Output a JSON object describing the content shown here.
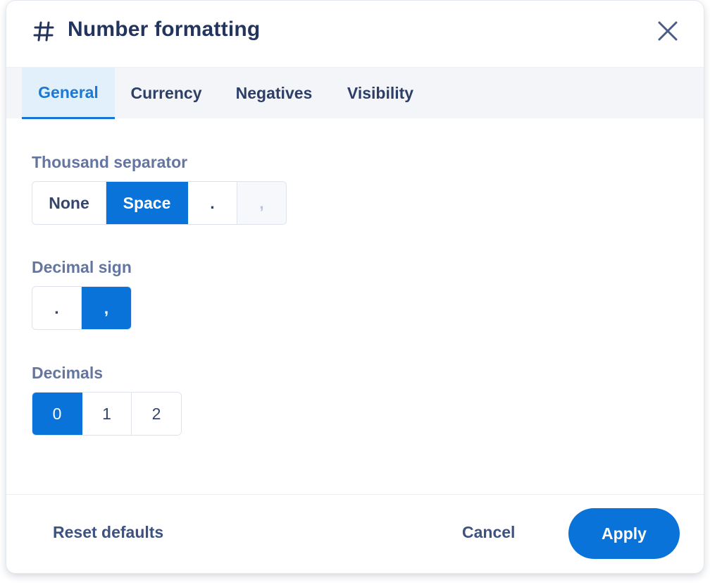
{
  "dialog": {
    "title": "Number formatting",
    "title_icon": "hash-icon",
    "close_icon": "close-icon"
  },
  "tabs": [
    {
      "label": "General",
      "active": true
    },
    {
      "label": "Currency",
      "active": false
    },
    {
      "label": "Negatives",
      "active": false
    },
    {
      "label": "Visibility",
      "active": false
    }
  ],
  "thousand_separator": {
    "label": "Thousand separator",
    "options": [
      {
        "label": "None",
        "state": "normal"
      },
      {
        "label": "Space",
        "state": "selected"
      },
      {
        "label": ".",
        "state": "normal"
      },
      {
        "label": ",",
        "state": "disabled"
      }
    ]
  },
  "decimal_sign": {
    "label": "Decimal sign",
    "options": [
      {
        "label": ".",
        "state": "normal"
      },
      {
        "label": ",",
        "state": "selected"
      }
    ]
  },
  "decimals": {
    "label": "Decimals",
    "options": [
      {
        "label": "0",
        "state": "selected"
      },
      {
        "label": "1",
        "state": "normal"
      },
      {
        "label": "2",
        "state": "normal"
      }
    ]
  },
  "footer": {
    "reset_label": "Reset defaults",
    "cancel_label": "Cancel",
    "apply_label": "Apply"
  },
  "colors": {
    "accent": "#0a73d9",
    "title_text": "#23345d",
    "label_text": "#6476a0",
    "tab_active_bg": "#e1f0fb"
  }
}
